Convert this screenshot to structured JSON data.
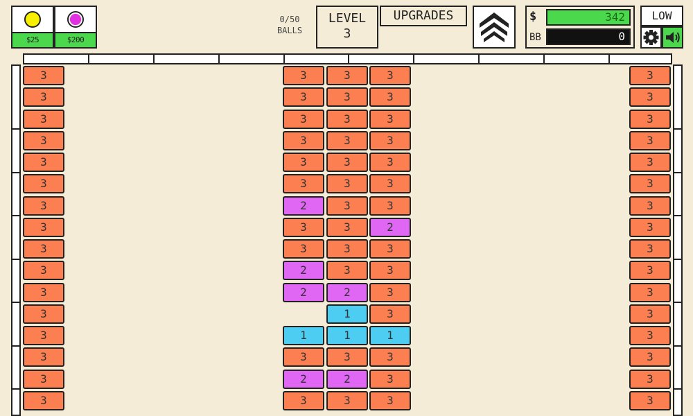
{
  "shop": [
    {
      "price": "$25",
      "ball_color": "#f8f000"
    },
    {
      "price": "$200",
      "ball_color": "#e030e0"
    }
  ],
  "balls": {
    "count": "0/50",
    "label": "BALLS"
  },
  "level": {
    "label": "LEVEL",
    "number": "3"
  },
  "upgrades_label": "UPGRADES",
  "money": {
    "symbol": "$",
    "value": "342",
    "bb_label": "BB",
    "bb_value": "0"
  },
  "quality_label": "LOW",
  "icons": [
    "chevron-up-icon",
    "gear-icon",
    "speaker-icon"
  ],
  "colors": {
    "hp3": "#fb7f50",
    "hp2": "#e066f4",
    "hp1": "#4dcdf1",
    "money_green": "#4cd84c",
    "background": "#f4ecd6"
  },
  "bricks": {
    "col1": [
      "3",
      "3",
      "3",
      "3",
      "3",
      "3",
      "3",
      "3",
      "3",
      "3",
      "3",
      "3",
      "3",
      "3",
      "3",
      "3"
    ],
    "col7": [
      "3",
      "3",
      "3",
      "3",
      "3",
      "3",
      "2",
      "3",
      "3",
      "2",
      "2",
      "",
      "1",
      "3",
      "2",
      "3"
    ],
    "col8": [
      "3",
      "3",
      "3",
      "3",
      "3",
      "3",
      "3",
      "3",
      "3",
      "3",
      "2",
      "1",
      "1",
      "3",
      "2",
      "3"
    ],
    "col9": [
      "3",
      "3",
      "3",
      "3",
      "3",
      "3",
      "3",
      "2",
      "3",
      "3",
      "3",
      "3",
      "1",
      "3",
      "3",
      "3"
    ],
    "col15": [
      "3",
      "3",
      "3",
      "3",
      "3",
      "3",
      "3",
      "3",
      "3",
      "3",
      "3",
      "3",
      "3",
      "3",
      "3",
      "3"
    ]
  }
}
